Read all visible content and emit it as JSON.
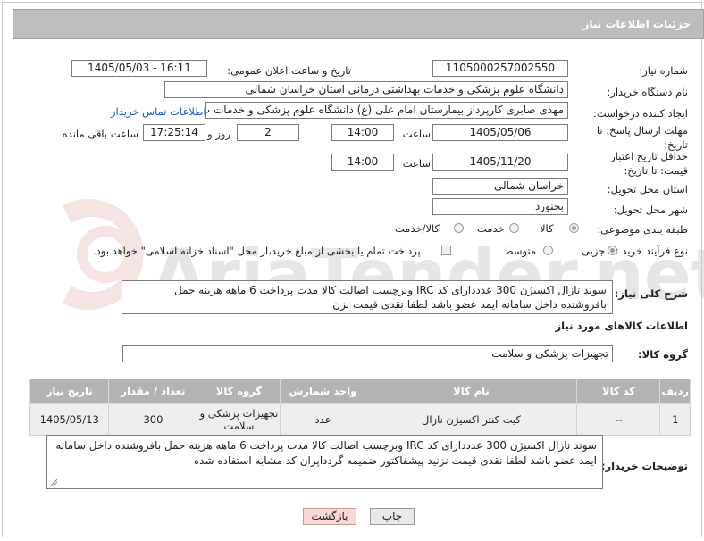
{
  "header": {
    "title": "جزئیات اطلاعات نیاز"
  },
  "fields": {
    "need_number_label": "شماره نیاز:",
    "need_number": "1105000257002550",
    "announce_label": "تاریخ و ساعت اعلان عمومی:",
    "announce_value": "1405/05/03 - 16:11",
    "buyer_label": "نام دستگاه خریدار:",
    "buyer_value": "دانشگاه علوم پزشکی و خدمات بهداشتی درمانی استان خراسان شمالی",
    "requester_label": "ایجاد کننده درخواست:",
    "requester_value": "مهدی صابری کارپرداز بیمارستان امام علی (ع) دانشگاه علوم پزشکی و خدمات ب",
    "contact_link": "اطلاعات تماس خریدار",
    "deadline_label": "مهلت ارسال پاسخ: تا تاریخ:",
    "deadline_date": "1405/05/06",
    "time_label": "ساعت",
    "deadline_time": "14:00",
    "days_value": "2",
    "days_label": "روز و",
    "remaining_time": "17:25:14",
    "remaining_label": "ساعت باقی مانده",
    "validity_label": "حداقل تاریخ اعتبار قیمت: تا تاریخ:",
    "validity_date": "1405/11/20",
    "validity_time": "14:00",
    "province_label": "استان محل تحویل:",
    "province_value": "خراسان شمالی",
    "city_label": "شهر محل تحویل:",
    "city_value": "بجنورد",
    "category_label": "طبقه بندی موضوعی:",
    "category_options": [
      "کالا",
      "خدمت",
      "کالا/خدمت"
    ],
    "category_selected": "کالا",
    "process_label": "نوع فرآیند خرید :",
    "process_options": [
      "جزیی",
      "متوسط"
    ],
    "process_selected": "جزیی",
    "payment_note": "پرداخت تمام یا بخشی از مبلغ خرید،از محل \"اسناد خزانه اسلامی\" خواهد بود."
  },
  "description": {
    "label": "شرح کلی نیاز:",
    "text": "سوند نازال اکسیژن 300 عدددارای کد IRC وبرچسب اصالت  کالا مدت پرداخت 6 ماهه هزینه حمل بافروشنده داخل سامانه ایمد عضو باشد لطفا نقدی قیمت نزن"
  },
  "goods": {
    "section_title": "اطلاعات کالاهای مورد نیاز",
    "group_label": "گروه کالا:",
    "group_value": "تجهیزات پزشکی و سلامت",
    "columns": [
      "ردیف",
      "کد کالا",
      "نام کالا",
      "واحد شمارش",
      "گروه کالا",
      "تعداد / مقدار",
      "تاریخ نیاز"
    ],
    "rows": [
      {
        "row": "1",
        "code": "--",
        "name": "کیت کنتر اکسیژن نازال",
        "unit": "عدد",
        "group": "تجهیزات پزشکی و سلامت",
        "qty": "300",
        "date": "1405/05/13"
      }
    ]
  },
  "buyer_notes": {
    "label": "توضیحات خریدار:",
    "text": "سوند نازال اکسیژن 300 عدددارای کد IRC وبرچسب اصالت  کالا مدت پرداخت 6 ماهه هزینه حمل بافروشنده داخل سامانه ایمد عضو باشد لطفا نقدی قیمت نزنید پیشفاکتور ضمیمه گردداپران کد مشابه استفاده شده"
  },
  "buttons": {
    "print": "چاپ",
    "back": "بازگشت"
  },
  "watermark": "AriaTender.net",
  "colors": {
    "header_bg": "#bdbdbd",
    "link": "#1a56c8",
    "back_button_bg": "#f9d7d7",
    "print_button_bg": "#e9e9e9"
  }
}
